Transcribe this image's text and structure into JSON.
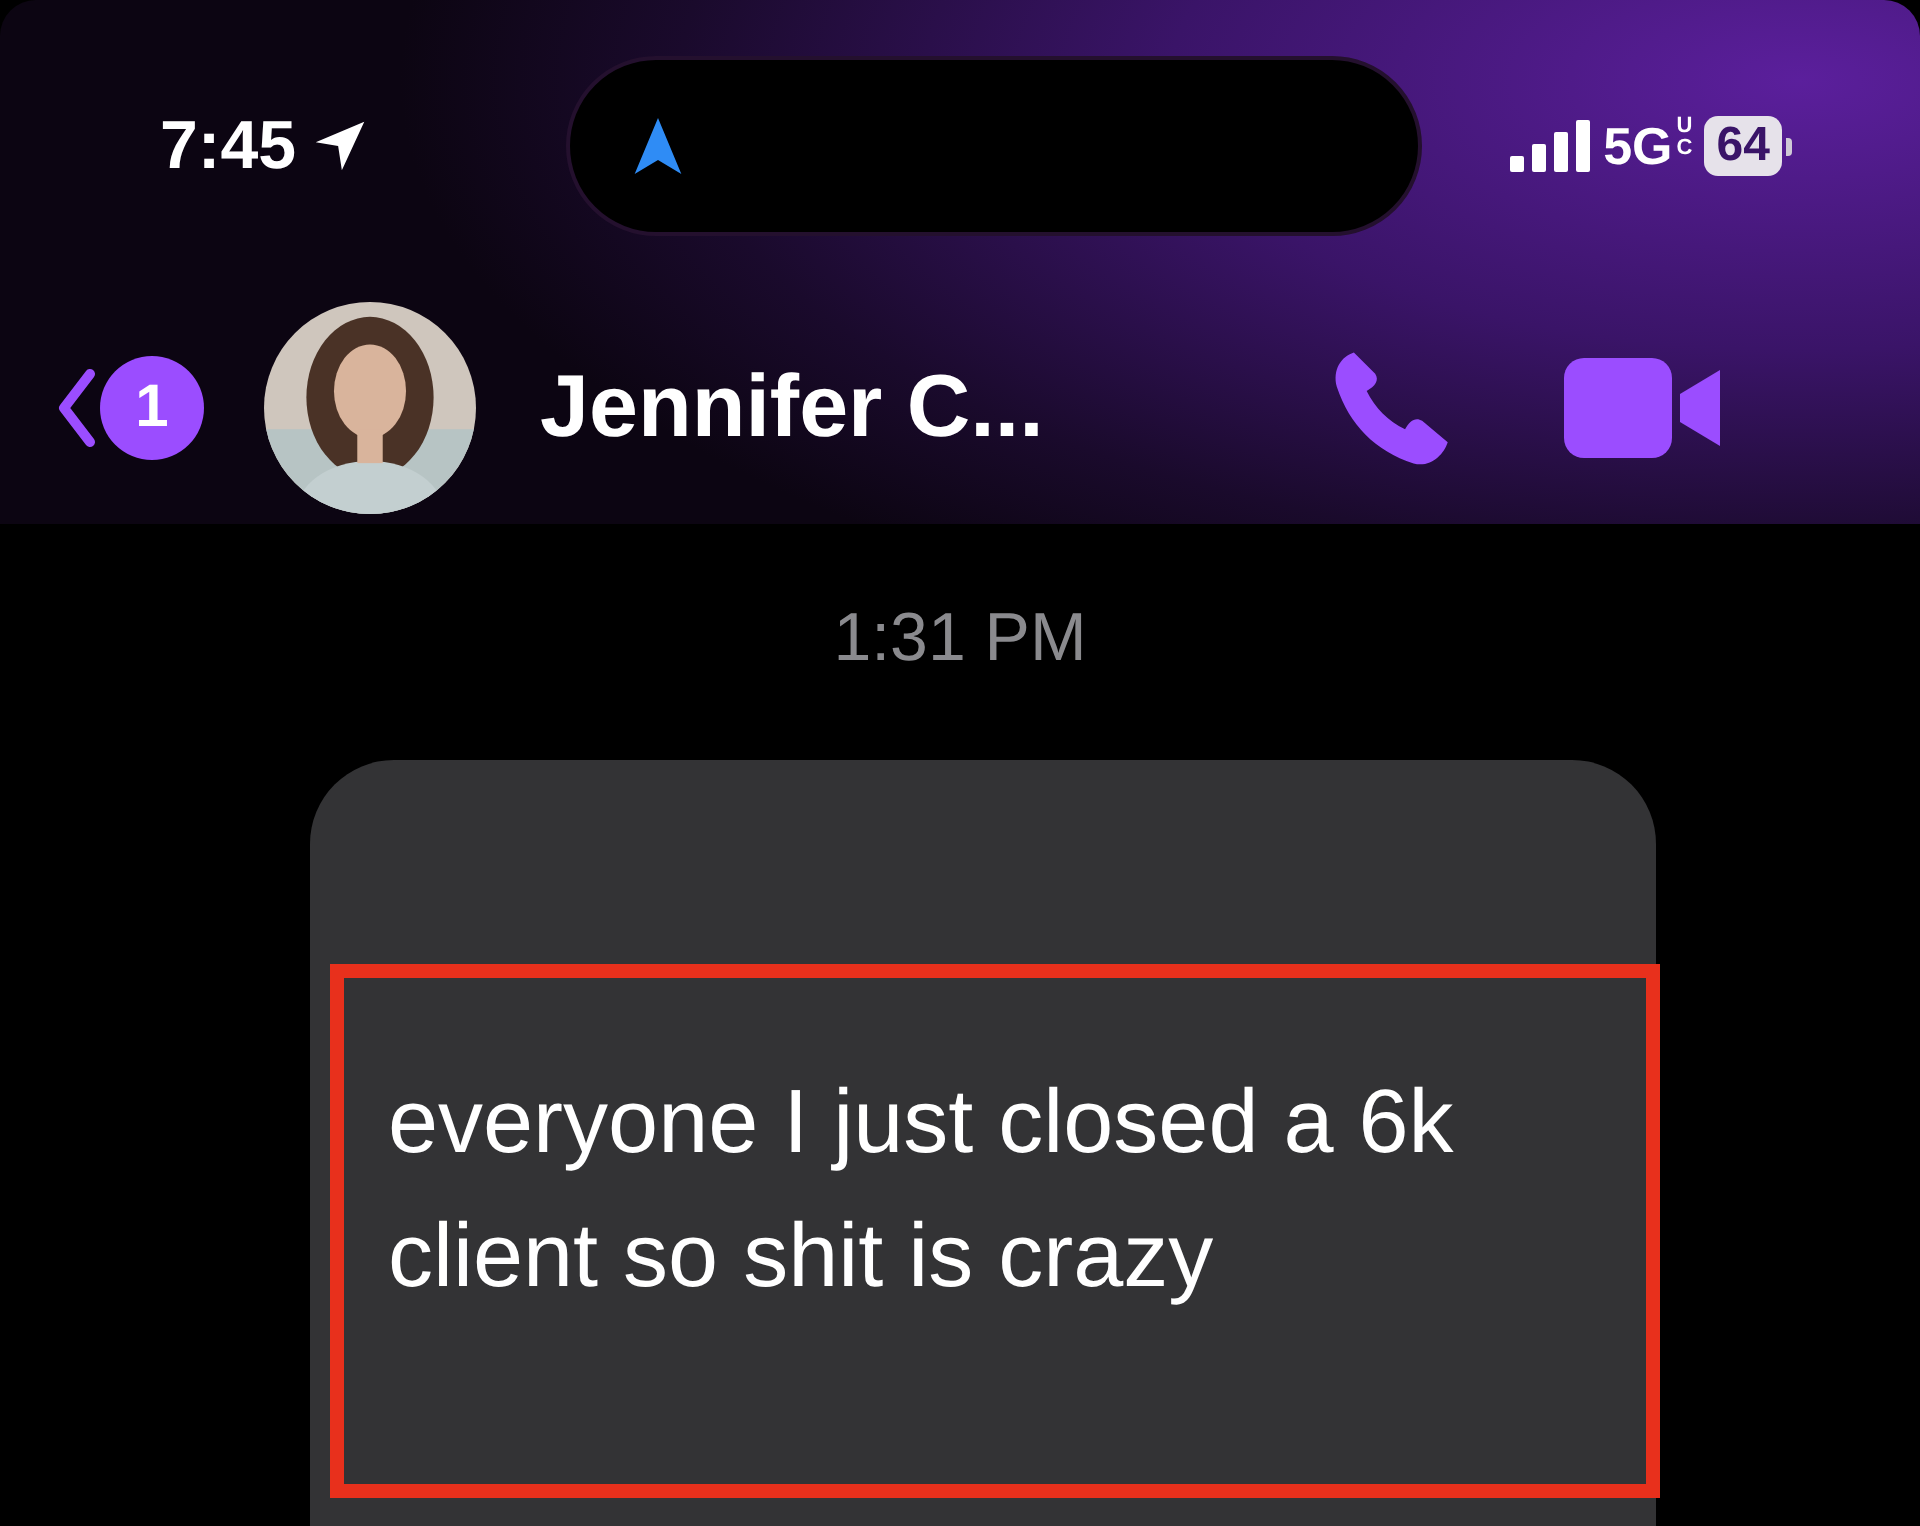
{
  "status_bar": {
    "time": "7:45",
    "network": "5G",
    "network_suffix": "UC",
    "battery": "64"
  },
  "header": {
    "back_badge": "1",
    "contact_name": "Jennifer C..."
  },
  "timestamp": "1:31 PM",
  "message": {
    "text": "everyone I just closed a 6k client so shit is crazy",
    "highlighted": true
  }
}
